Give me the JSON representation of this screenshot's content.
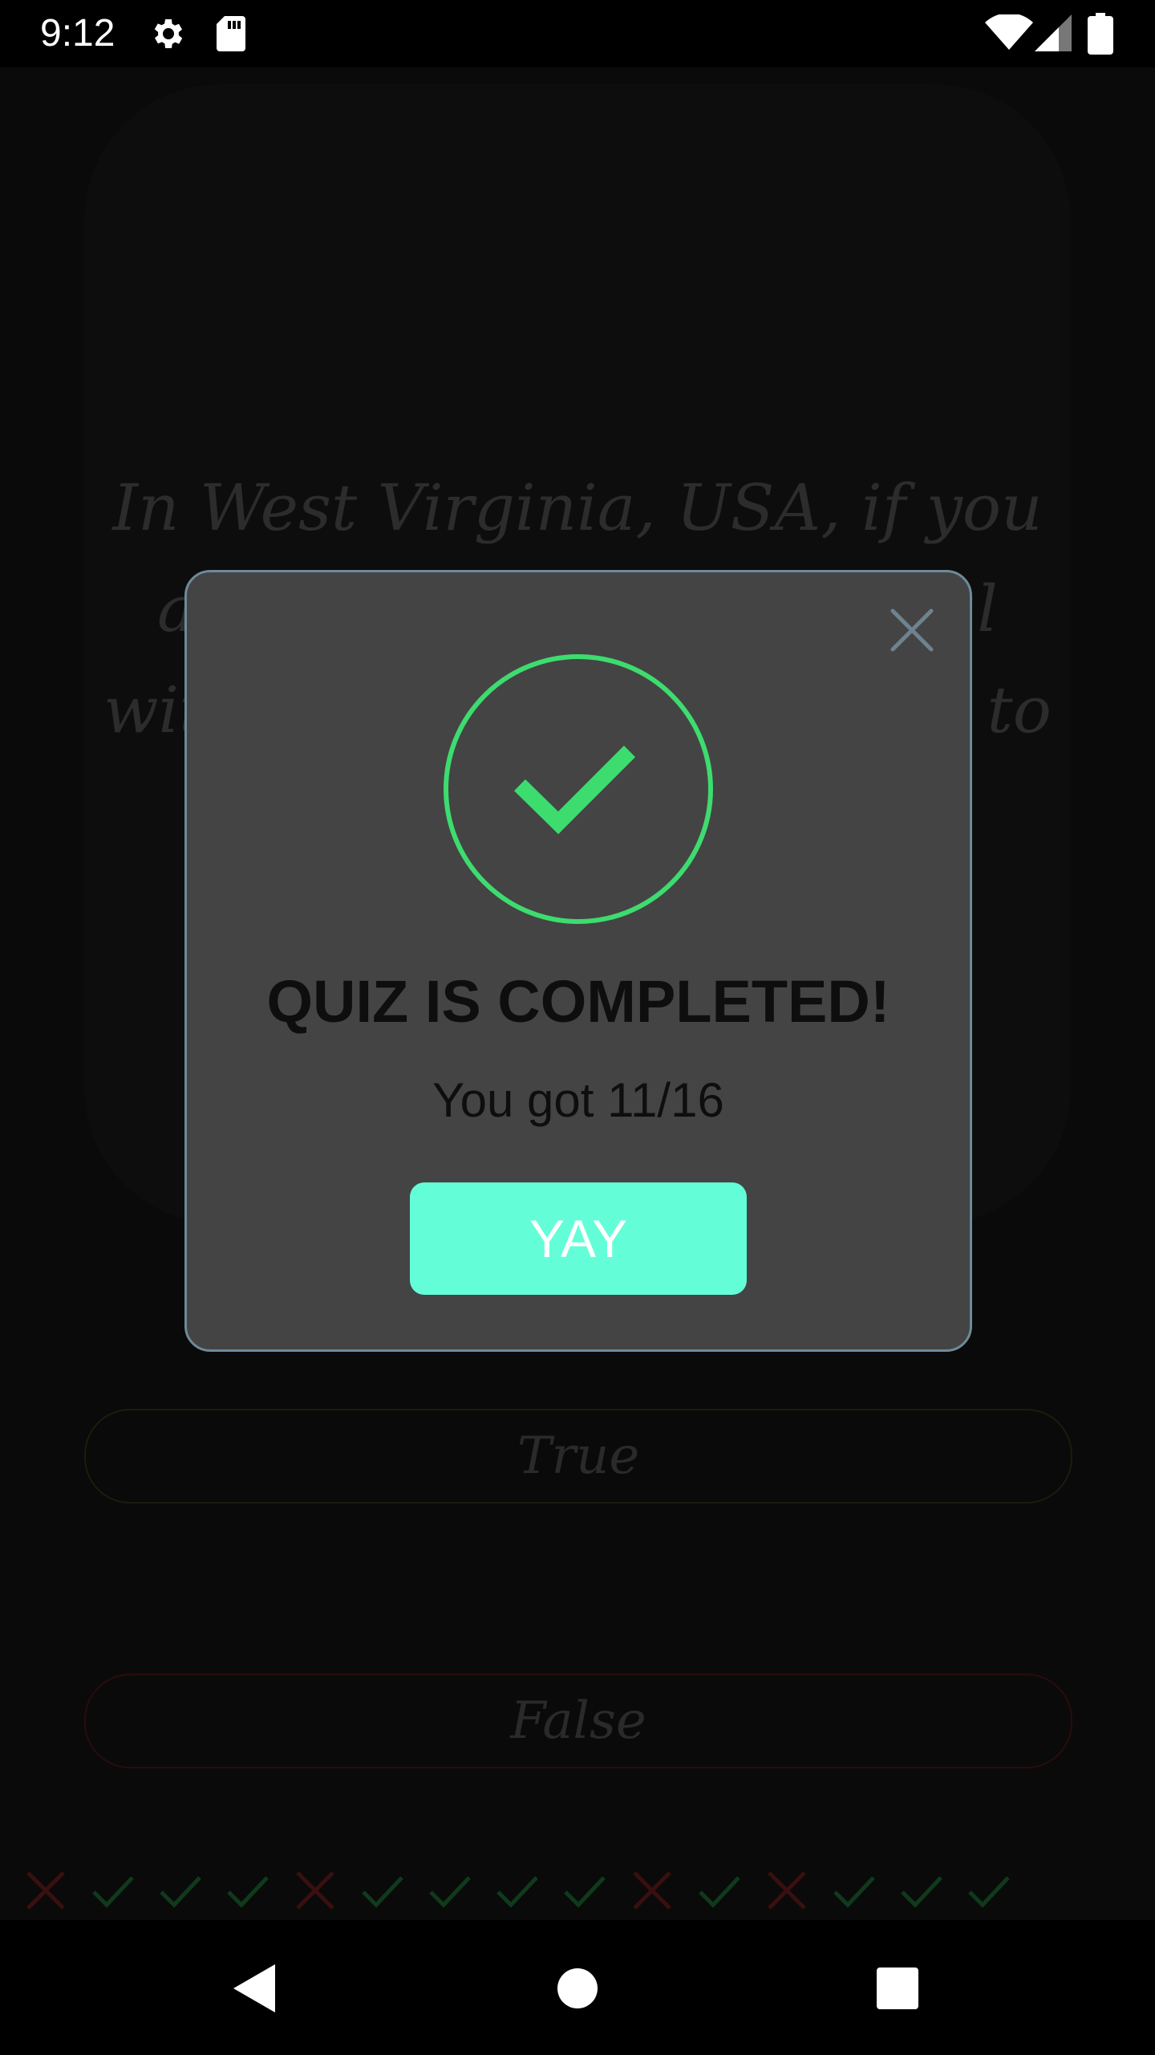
{
  "status_bar": {
    "time": "9:12",
    "icons": [
      "settings-icon",
      "sd-card-icon",
      "wifi-icon",
      "signal-icon",
      "battery-icon"
    ]
  },
  "quiz": {
    "question": "In West Virginia, USA, if you accidentally hit an animal with your car, you are free to take it home to eat.",
    "answers": {
      "true_label": "True",
      "false_label": "False"
    },
    "progress": [
      "wrong",
      "correct",
      "correct",
      "correct",
      "wrong",
      "correct",
      "correct",
      "correct",
      "correct",
      "wrong",
      "correct",
      "wrong",
      "correct",
      "correct",
      "correct"
    ]
  },
  "dialog": {
    "title": "QUIZ IS COMPLETED!",
    "score_text": "You got 11/16",
    "confirm_label": "YAY",
    "close_icon": "close-icon",
    "status_icon": "check-circle-icon"
  },
  "colors": {
    "success_green": "#3ddc6f",
    "accent_teal": "#63fed8",
    "dialog_bg": "#444444",
    "wrong_red": "#3a0f0f",
    "correct_green": "#0f3a1c"
  },
  "nav_bar": {
    "icons": [
      "back-icon",
      "home-icon",
      "recents-icon"
    ]
  }
}
